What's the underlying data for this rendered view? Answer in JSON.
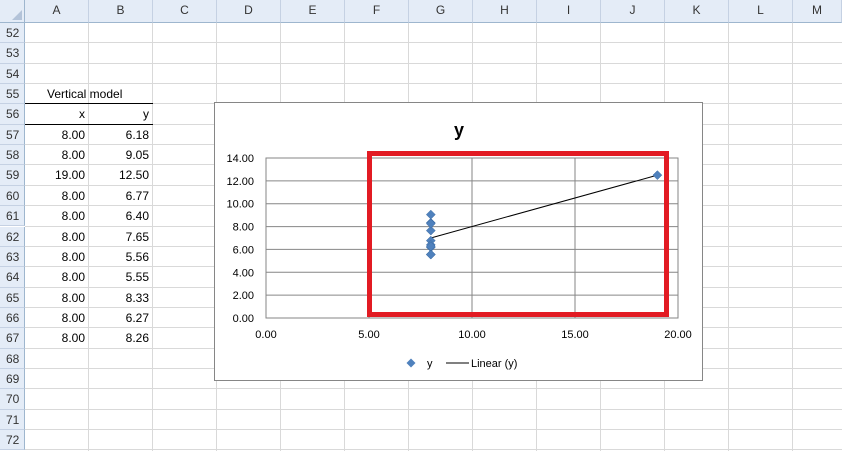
{
  "sheet": {
    "columns": [
      "A",
      "B",
      "C",
      "D",
      "E",
      "F",
      "G",
      "H",
      "I",
      "J",
      "K",
      "L",
      "M"
    ],
    "rows": [
      "52",
      "53",
      "54",
      "55",
      "56",
      "57",
      "58",
      "59",
      "60",
      "61",
      "62",
      "63",
      "64",
      "65",
      "66",
      "67",
      "68",
      "69",
      "70",
      "71",
      "72"
    ],
    "table": {
      "title": "Vertical model",
      "headers": [
        "x",
        "y"
      ],
      "rows": [
        [
          "8.00",
          "6.18"
        ],
        [
          "8.00",
          "9.05"
        ],
        [
          "19.00",
          "12.50"
        ],
        [
          "8.00",
          "6.77"
        ],
        [
          "8.00",
          "6.40"
        ],
        [
          "8.00",
          "7.65"
        ],
        [
          "8.00",
          "5.56"
        ],
        [
          "8.00",
          "5.55"
        ],
        [
          "8.00",
          "8.33"
        ],
        [
          "8.00",
          "6.27"
        ],
        [
          "8.00",
          "8.26"
        ]
      ]
    }
  },
  "chart_data": {
    "type": "scatter",
    "title": "y",
    "xlabel": "",
    "ylabel": "",
    "xlim": [
      0,
      20
    ],
    "ylim": [
      0,
      14
    ],
    "x_ticks": [
      "0.00",
      "5.00",
      "10.00",
      "15.00",
      "20.00"
    ],
    "y_ticks": [
      "0.00",
      "2.00",
      "4.00",
      "6.00",
      "8.00",
      "10.00",
      "12.00",
      "14.00"
    ],
    "grid": true,
    "legend_position": "bottom",
    "series": [
      {
        "name": "y",
        "marker": "diamond",
        "color": "#4f81bd",
        "x": [
          8,
          8,
          19,
          8,
          8,
          8,
          8,
          8,
          8,
          8,
          8
        ],
        "y": [
          6.18,
          9.05,
          12.5,
          6.77,
          6.4,
          7.65,
          5.56,
          5.55,
          8.33,
          6.27,
          8.26
        ]
      }
    ],
    "trendline": {
      "name": "Linear (y)",
      "type": "linear",
      "color": "#000000",
      "x": [
        8,
        19
      ]
    }
  },
  "annotation": {
    "highlight_color": "#e21b23"
  }
}
